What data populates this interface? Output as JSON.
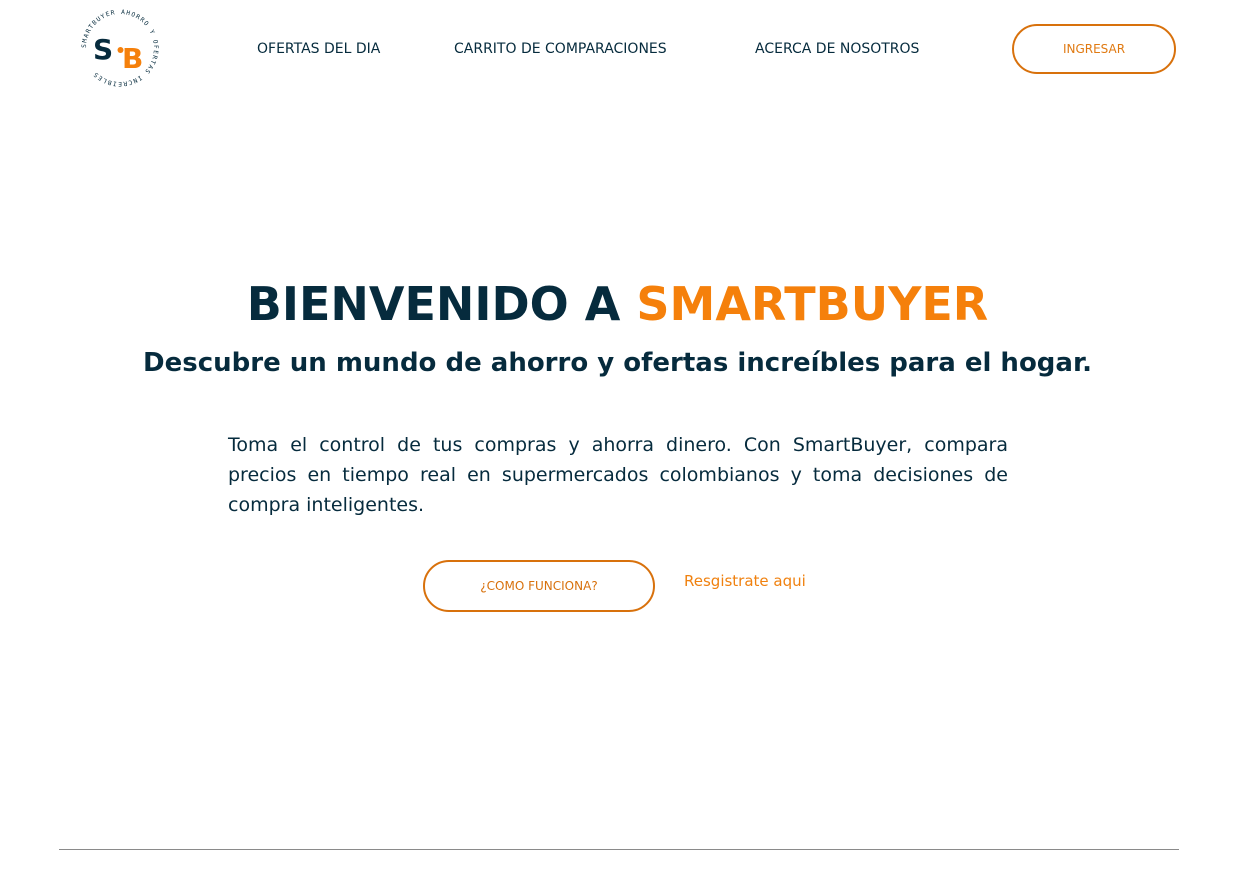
{
  "brand": {
    "logo_initials_left": "S",
    "logo_initials_right": "B",
    "logo_ring_text": "SMARTBUYER AHORRO Y OFERTAS INCREIBLES",
    "colors": {
      "navy": "#062b3d",
      "orange": "#f5800b",
      "orange_dark": "#d8710c"
    }
  },
  "nav": {
    "items": [
      {
        "label": "OFERTAS DEL DIA"
      },
      {
        "label": "CARRITO DE COMPARACIONES"
      },
      {
        "label": "ACERCA DE NOSOTROS"
      }
    ],
    "login_label": "INGRESAR"
  },
  "hero": {
    "title_prefix": "BIENVENIDO A",
    "title_accent": "SMARTBUYER",
    "subtitle": "Descubre un mundo de ahorro y ofertas increíbles para el hogar.",
    "body": "Toma el control de tus compras y ahorra dinero. Con SmartBuyer, compara precios en tiempo real en supermercados colombianos y toma decisiones de compra inteligentes.",
    "how_button_label": "¿COMO FUNCIONA?",
    "register_link_label": "Resgistrate aqui"
  }
}
